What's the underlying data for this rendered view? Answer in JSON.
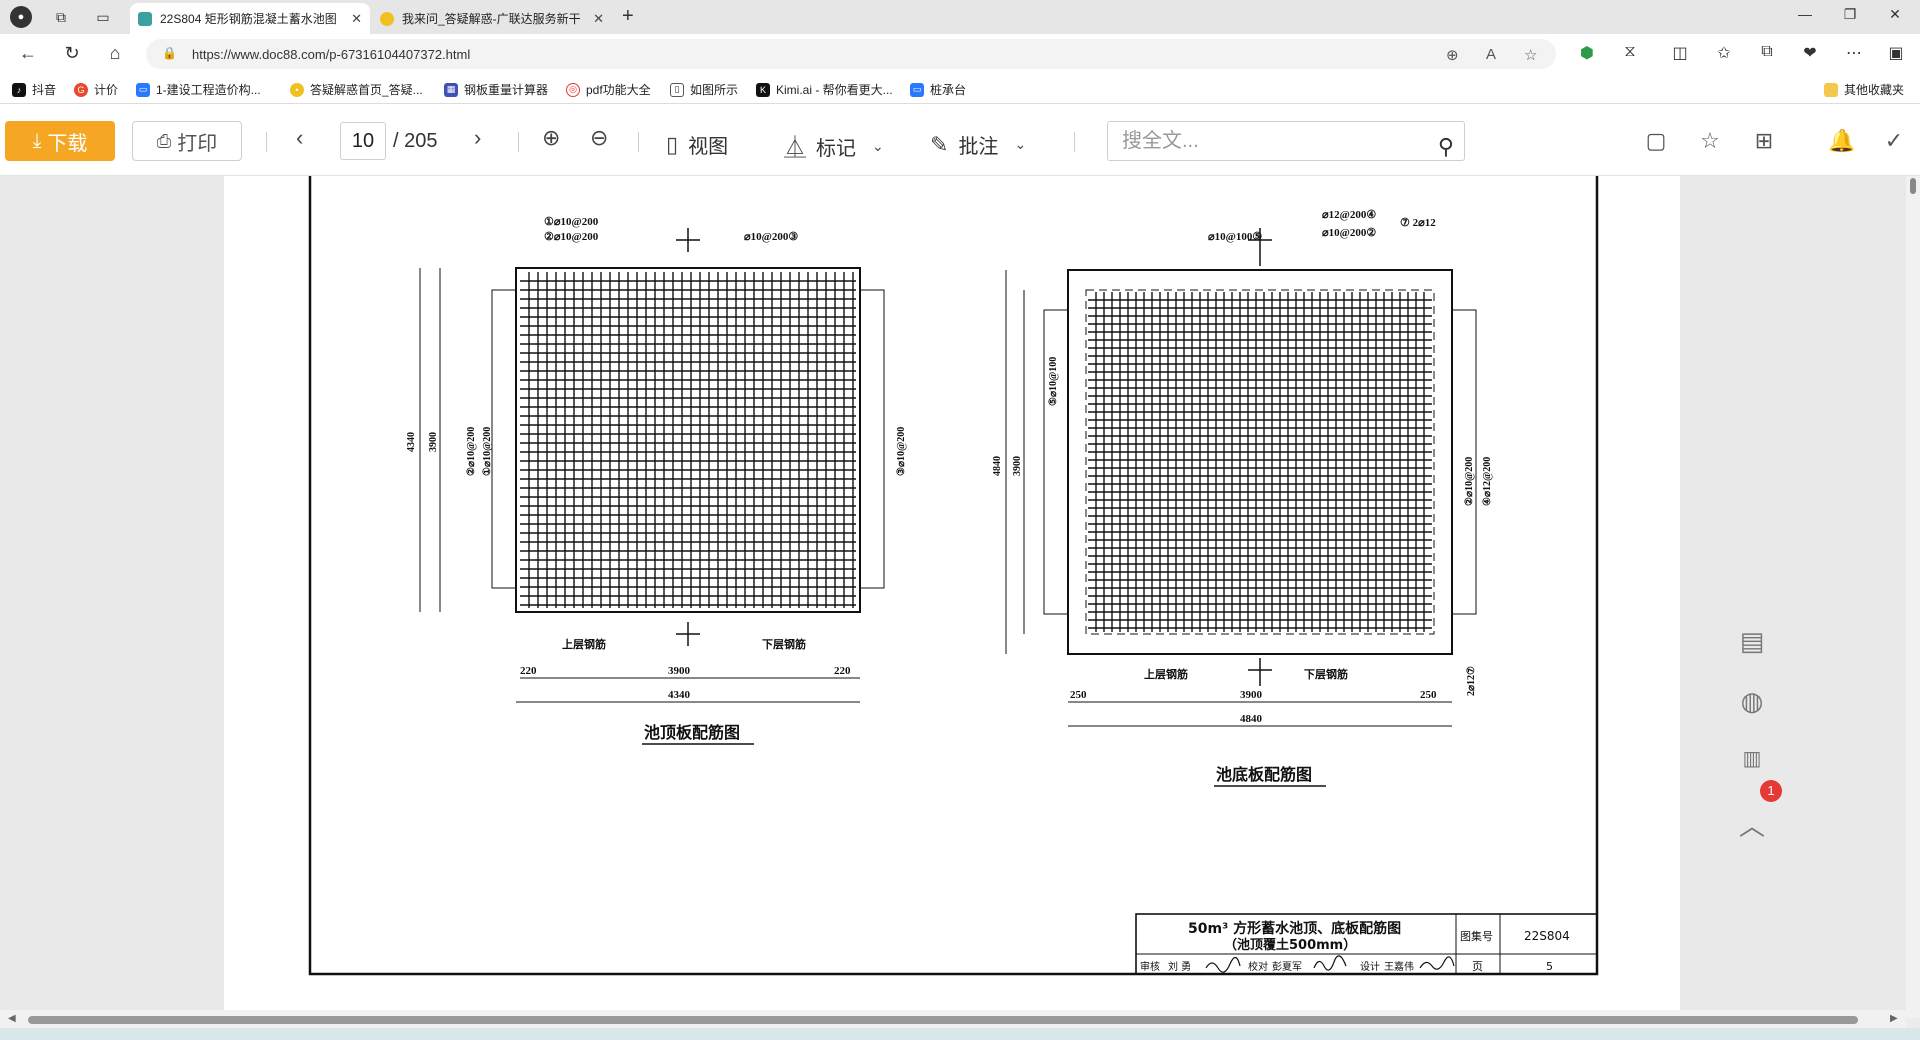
{
  "browser": {
    "tabs": [
      {
        "title": "22S804 矩形钢筋混凝土蓄水池图",
        "active": true
      },
      {
        "title": "我来问_答疑解惑-广联达服务新干",
        "active": false
      }
    ],
    "url": "https://www.doc88.com/p-67316104407372.html"
  },
  "bookmarks": [
    {
      "label": "抖音",
      "icon": "douyin-icon"
    },
    {
      "label": "计价",
      "icon": "glodon-icon"
    },
    {
      "label": "1-建设工程造价构...",
      "icon": "tv-icon"
    },
    {
      "label": "答疑解惑首页_答疑...",
      "icon": "bulb-icon"
    },
    {
      "label": "钢板重量计算器",
      "icon": "grid-icon"
    },
    {
      "label": "pdf功能大全",
      "icon": "pdf-icon"
    },
    {
      "label": "如图所示",
      "icon": "doc-icon"
    },
    {
      "label": "Kimi.ai - 帮你看更大...",
      "icon": "kimi-icon"
    },
    {
      "label": "桩承台",
      "icon": "tv-icon"
    }
  ],
  "bookmarks_other": "其他收藏夹",
  "toolbar": {
    "download": "下载",
    "print": "打印",
    "page_current": "10",
    "page_total": "/ 205",
    "view": "视图",
    "mark": "标记",
    "annotate": "批注",
    "search_placeholder": "搜全文..."
  },
  "drawing": {
    "top_title": "池顶板配筋图",
    "bottom_title": "池底板配筋图",
    "upper": "上层钢筋",
    "lower": "下层钢筋",
    "dims": {
      "d220": "220",
      "d250": "220",
      "d250b": "250",
      "d3900": "3900",
      "d4340": "4340",
      "d4840": "4840"
    },
    "rebar": {
      "t1": "①⌀10@200",
      "t2": "②⌀10@200",
      "t3": "⌀10@200③",
      "t_left1": "②⌀10@200",
      "t_left2": "①⌀10@200",
      "t_right": "③⌀10@200",
      "b1": "⌀12@200④",
      "b2": "⌀10@200②",
      "b3": "⑦ 2⌀12",
      "b4": "⌀10@100⑤",
      "b5": "⑤⌀10@100",
      "b6": "②⌀10@200",
      "b7": "④⌀12@200",
      "b8": "2⌀12⑦"
    },
    "titleblock": {
      "title": "50m³ 方形蓄水池顶、底板配筋图",
      "subtitle": "（池顶覆土500mm）",
      "atlas_label": "图集号",
      "atlas_no": "22S804",
      "page_label": "页",
      "page_no": "5",
      "review": "审核",
      "reviewer": "刘 勇",
      "check": "校对",
      "checker": "彭夏军",
      "design": "设计",
      "designer": "王嘉伟"
    }
  },
  "side_badge": "1"
}
